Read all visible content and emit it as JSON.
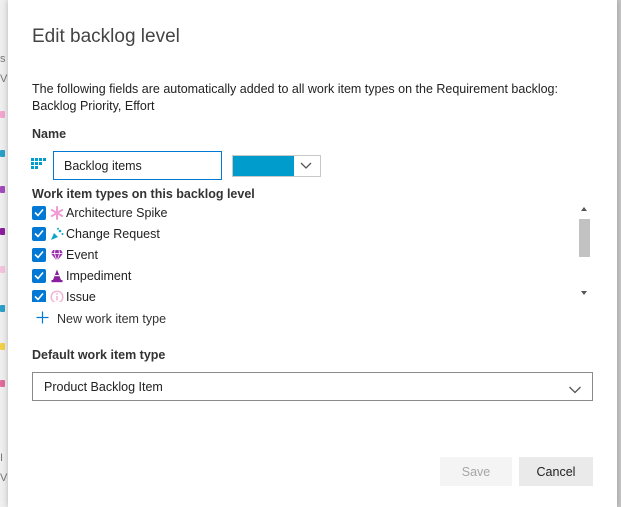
{
  "dialog": {
    "title": "Edit backlog level",
    "info_text": "The following fields are automatically added to all work item types on the Requirement backlog: Backlog Priority, Effort"
  },
  "name_section": {
    "label": "Name",
    "value": "Backlog items",
    "color": "#009ccc"
  },
  "types_section": {
    "label": "Work item types on this backlog level",
    "items": [
      {
        "label": "Architecture Spike",
        "checked": true,
        "icon": "asterisk-icon",
        "color": "#f09bd3"
      },
      {
        "label": "Change Request",
        "checked": true,
        "icon": "firework-icon",
        "color": "#0aa8c6"
      },
      {
        "label": "Event",
        "checked": true,
        "icon": "gem-icon",
        "color": "#9b2fae"
      },
      {
        "label": "Impediment",
        "checked": true,
        "icon": "cone-icon",
        "color": "#8a1f9e"
      },
      {
        "label": "Issue",
        "checked": true,
        "icon": "info-circle-icon",
        "color": "#f2b6d5"
      }
    ],
    "add_label": "New work item type"
  },
  "default_section": {
    "label": "Default work item type",
    "selected": "Product Backlog Item"
  },
  "buttons": {
    "save": "Save",
    "cancel": "Cancel"
  },
  "colors": {
    "accent": "#0078d4",
    "disabled_text": "#a6a6a6"
  }
}
